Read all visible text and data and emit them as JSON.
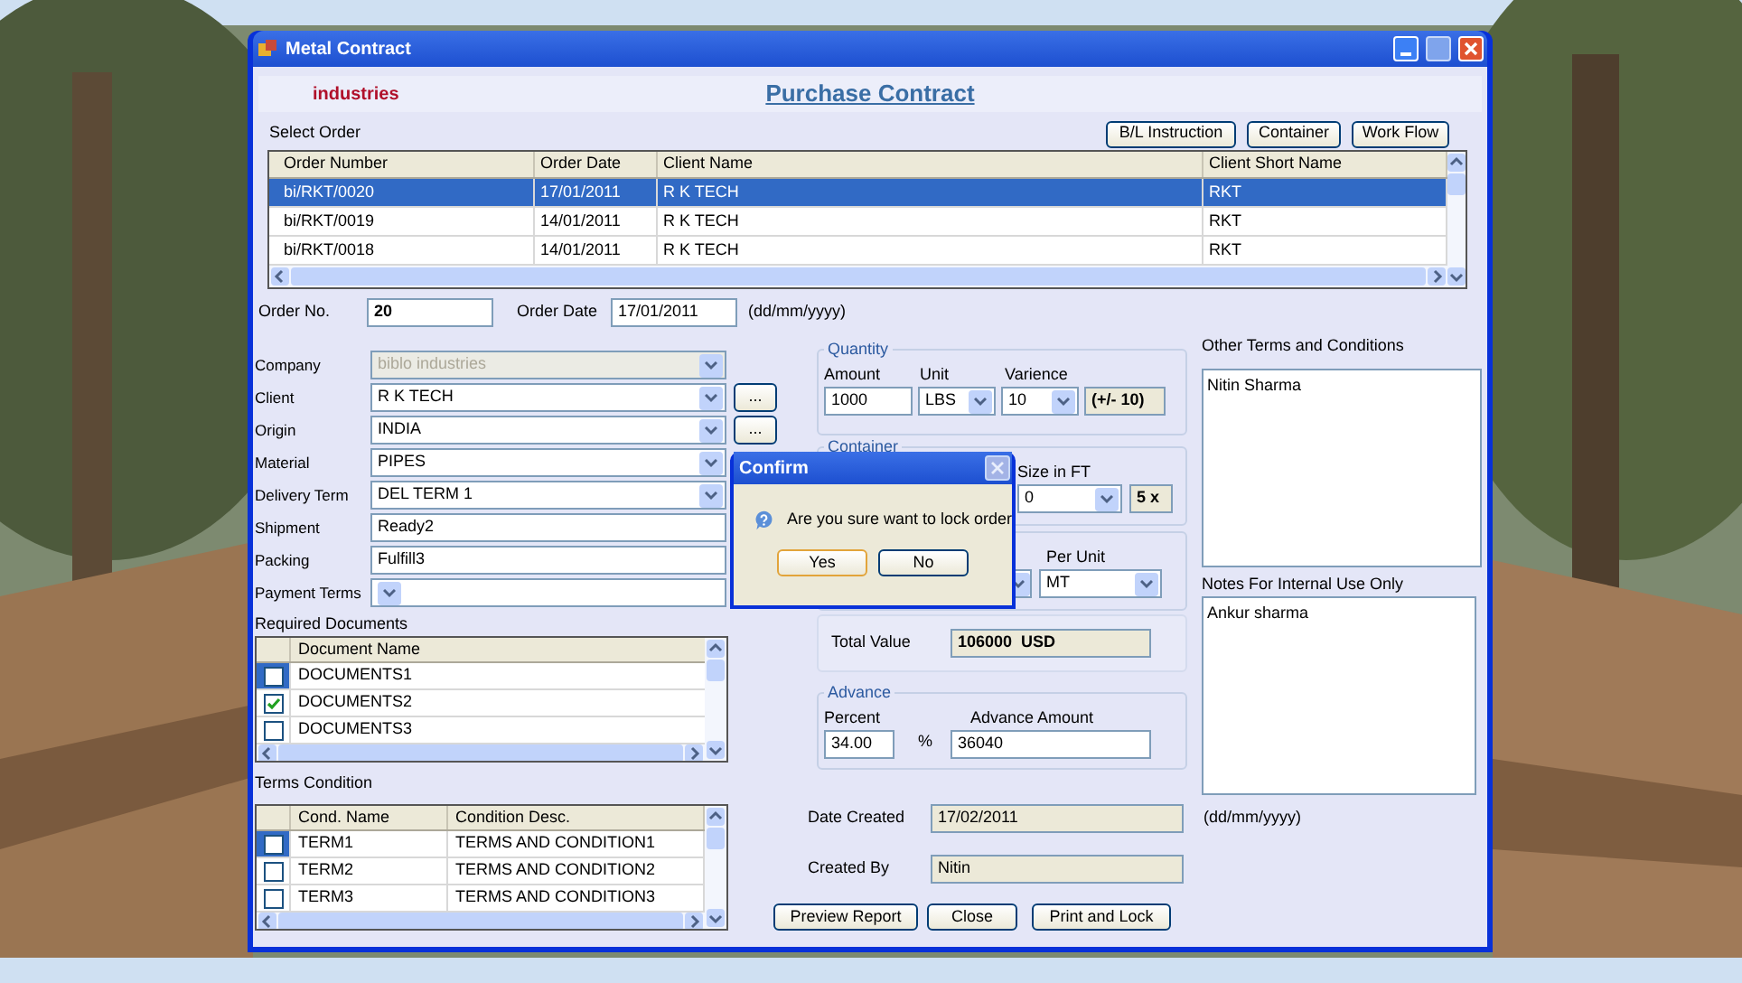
{
  "window": {
    "title": "Metal Contract"
  },
  "header": {
    "company": "industries",
    "title": "Purchase Contract"
  },
  "select_order": {
    "label": "Select Order",
    "buttons": [
      "B/L Instruction",
      "Container",
      "Work Flow"
    ],
    "columns": [
      "Order Number",
      "Order Date",
      "Client Name",
      "Client Short Name"
    ],
    "rows": [
      {
        "cells": [
          "bi/RKT/0020",
          "17/01/2011",
          "R K TECH",
          "RKT"
        ],
        "selected": true
      },
      {
        "cells": [
          "bi/RKT/0019",
          "14/01/2011",
          "R K TECH",
          "RKT"
        ],
        "selected": false
      },
      {
        "cells": [
          "bi/RKT/0018",
          "14/01/2011",
          "R K TECH",
          "RKT"
        ],
        "selected": false
      }
    ]
  },
  "order": {
    "order_no_label": "Order No.",
    "order_no": "20",
    "order_date_label": "Order Date",
    "order_date": "17/01/2011",
    "date_hint": "(dd/mm/yyyy)"
  },
  "fields": [
    {
      "label": "Company",
      "value": "biblo industries",
      "kind": "dropdown",
      "disabled": true
    },
    {
      "label": "Client",
      "value": "R K TECH",
      "kind": "dropdown",
      "disabled": false,
      "browse": "..."
    },
    {
      "label": "Origin",
      "value": "INDIA",
      "kind": "dropdown",
      "disabled": false,
      "browse": "..."
    },
    {
      "label": "Material",
      "value": "PIPES",
      "kind": "dropdown",
      "disabled": false
    },
    {
      "label": "Delivery Term",
      "value": "DEL TERM 1",
      "kind": "dropdown",
      "disabled": false
    },
    {
      "label": "Shipment",
      "value": "Ready2",
      "kind": "text",
      "disabled": false
    },
    {
      "label": "Packing",
      "value": "Fulfill3",
      "kind": "text",
      "disabled": false
    },
    {
      "label": "Payment Terms",
      "kind": "dropdown",
      "disabled": false
    }
  ],
  "documents": {
    "label": "Required Documents",
    "column": "Document Name",
    "rows": [
      {
        "name": "DOCUMENTS1",
        "checked": false,
        "selected": true
      },
      {
        "name": "DOCUMENTS2",
        "checked": true,
        "selected": false
      },
      {
        "name": "DOCUMENTS3",
        "checked": false,
        "selected": false
      }
    ]
  },
  "terms": {
    "label": "Terms Condition",
    "columns": [
      "Cond. Name",
      "Condition Desc."
    ],
    "rows": [
      {
        "cells": [
          "TERM1",
          "TERMS AND CONDITION1"
        ],
        "checked": false,
        "selected": true
      },
      {
        "cells": [
          "TERM2",
          "TERMS AND CONDITION2"
        ],
        "checked": false,
        "selected": false
      },
      {
        "cells": [
          "TERM3",
          "TERMS AND CONDITION3"
        ],
        "checked": false,
        "selected": false
      }
    ]
  },
  "quantity": {
    "title": "Quantity",
    "amount_label": "Amount",
    "amount": "1000",
    "unit_label": "Unit",
    "unit": "LBS",
    "variance_label": "Varience",
    "variance": "10",
    "variance_note": "(+/- 10)"
  },
  "container": {
    "title": "Container",
    "size_label": "Size in FT",
    "size": "0",
    "count": "5 x"
  },
  "price": {
    "per_unit_label": "Per Unit",
    "per_unit": "MT"
  },
  "total": {
    "label": "Total Value",
    "value": "106000  USD"
  },
  "advance": {
    "title": "Advance",
    "percent_label": "Percent",
    "percent": "34.00",
    "percent_sign": "%",
    "amount_label": "Advance Amount",
    "amount": "36040"
  },
  "other_terms": {
    "label": "Other Terms and Conditions",
    "value": "Nitin Sharma"
  },
  "notes": {
    "label": "Notes For Internal Use Only",
    "value": "Ankur sharma"
  },
  "created": {
    "date_label": "Date Created",
    "date": "17/02/2011",
    "date_hint": "(dd/mm/yyyy)",
    "by_label": "Created By",
    "by": "Nitin"
  },
  "buttons": [
    "Preview Report",
    "Close",
    "Print and Lock"
  ],
  "dialog": {
    "title": "Confirm",
    "message": "Are you sure want to lock order",
    "buttons": [
      "Yes",
      "No"
    ]
  }
}
